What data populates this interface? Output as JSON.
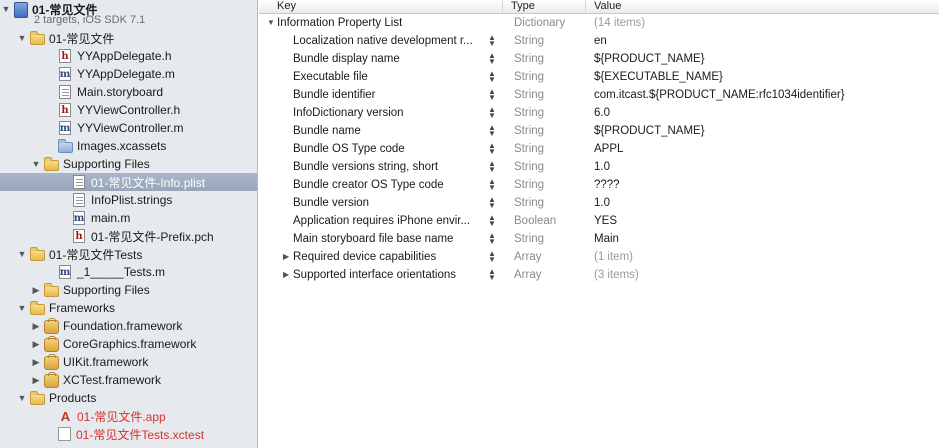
{
  "navigator": {
    "project": {
      "name": "01-常见文件",
      "subtitle": "2 targets, iOS SDK 7.1"
    },
    "items": [
      {
        "label": "01-常见文件",
        "icon": "folder-icon",
        "disclosure": "open",
        "indent": 16
      },
      {
        "label": "YYAppDelegate.h",
        "icon": "header-file-icon",
        "indent": 44
      },
      {
        "label": "YYAppDelegate.m",
        "icon": "source-file-icon",
        "indent": 44
      },
      {
        "label": "Main.storyboard",
        "icon": "storyboard-icon",
        "indent": 44
      },
      {
        "label": "YYViewController.h",
        "icon": "header-file-icon",
        "indent": 44
      },
      {
        "label": "YYViewController.m",
        "icon": "source-file-icon",
        "indent": 44
      },
      {
        "label": "Images.xcassets",
        "icon": "asset-catalog-icon",
        "indent": 44
      },
      {
        "label": "Supporting Files",
        "icon": "folder-icon",
        "disclosure": "open",
        "indent": 30
      },
      {
        "label": "01-常见文件-Info.plist",
        "icon": "plist-file-icon",
        "indent": 58,
        "selected": true
      },
      {
        "label": "InfoPlist.strings",
        "icon": "strings-file-icon",
        "indent": 58
      },
      {
        "label": "main.m",
        "icon": "source-file-icon",
        "indent": 58
      },
      {
        "label": "01-常见文件-Prefix.pch",
        "icon": "header-file-icon",
        "indent": 58
      },
      {
        "label": "01-常见文件Tests",
        "icon": "folder-icon",
        "disclosure": "open",
        "indent": 16
      },
      {
        "label": "_1_____Tests.m",
        "icon": "source-file-icon",
        "indent": 44
      },
      {
        "label": "Supporting Files",
        "icon": "folder-icon",
        "disclosure": "closed",
        "indent": 30
      },
      {
        "label": "Frameworks",
        "icon": "folder-icon",
        "disclosure": "open",
        "indent": 16
      },
      {
        "label": "Foundation.framework",
        "icon": "framework-icon",
        "disclosure": "closed",
        "indent": 30
      },
      {
        "label": "CoreGraphics.framework",
        "icon": "framework-icon",
        "disclosure": "closed",
        "indent": 30
      },
      {
        "label": "UIKit.framework",
        "icon": "framework-icon",
        "disclosure": "closed",
        "indent": 30
      },
      {
        "label": "XCTest.framework",
        "icon": "framework-icon",
        "disclosure": "closed",
        "indent": 30
      },
      {
        "label": "Products",
        "icon": "folder-icon",
        "disclosure": "open",
        "indent": 16
      },
      {
        "label": "01-常见文件.app",
        "icon": "app-product-icon",
        "indent": 44,
        "red": true
      },
      {
        "label": "01-常见文件Tests.xctest",
        "icon": "xctest-product-icon",
        "indent": 44,
        "red": true
      }
    ]
  },
  "plist": {
    "columns": {
      "key": "Key",
      "type": "Type",
      "value": "Value"
    },
    "root": {
      "key": "Information Property List",
      "type": "Dictionary",
      "value": "(14 items)"
    },
    "rows": [
      {
        "key": "Localization native development r...",
        "type": "String",
        "value": "en"
      },
      {
        "key": "Bundle display name",
        "type": "String",
        "value": "${PRODUCT_NAME}"
      },
      {
        "key": "Executable file",
        "type": "String",
        "value": "${EXECUTABLE_NAME}"
      },
      {
        "key": "Bundle identifier",
        "type": "String",
        "value": "com.itcast.${PRODUCT_NAME:rfc1034identifier}"
      },
      {
        "key": "InfoDictionary version",
        "type": "String",
        "value": "6.0"
      },
      {
        "key": "Bundle name",
        "type": "String",
        "value": "${PRODUCT_NAME}"
      },
      {
        "key": "Bundle OS Type code",
        "type": "String",
        "value": "APPL"
      },
      {
        "key": "Bundle versions string, short",
        "type": "String",
        "value": "1.0"
      },
      {
        "key": "Bundle creator OS Type code",
        "type": "String",
        "value": "????"
      },
      {
        "key": "Bundle version",
        "type": "String",
        "value": "1.0"
      },
      {
        "key": "Application requires iPhone envir...",
        "type": "Boolean",
        "value": "YES"
      },
      {
        "key": "Main storyboard file base name",
        "type": "String",
        "value": "Main"
      },
      {
        "key": "Required device capabilities",
        "type": "Array",
        "value": "(1 item)",
        "expandable": true
      },
      {
        "key": "Supported interface orientations",
        "type": "Array",
        "value": "(3 items)",
        "expandable": true
      }
    ]
  }
}
